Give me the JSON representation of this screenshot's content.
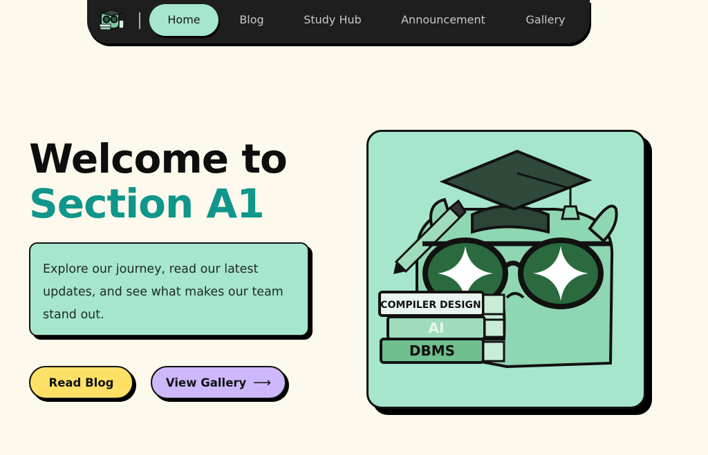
{
  "nav": {
    "items": [
      {
        "label": "Home",
        "active": true
      },
      {
        "label": "Blog",
        "active": false
      },
      {
        "label": "Study Hub",
        "active": false
      },
      {
        "label": "Announcement",
        "active": false
      },
      {
        "label": "Gallery",
        "active": false
      }
    ]
  },
  "hero": {
    "line1": "Welcome to",
    "line2": "Section A1",
    "description": "Explore our journey, read our latest updates, and see what makes our team stand out."
  },
  "buttons": {
    "read_blog": "Read Blog",
    "view_gallery": "View Gallery",
    "view_gallery_arrow": "⟶"
  },
  "mascot": {
    "books": [
      "COMPILER DESIGN",
      "AI",
      "DBMS"
    ]
  },
  "colors": {
    "background": "#fdf9ec",
    "nav": "#1e1e1e",
    "mint": "#a6e6cd",
    "teal_accent": "#10968a",
    "yellow": "#ffe066",
    "lavender": "#cdb8fb"
  },
  "icons": [
    "logo-icon",
    "arrow-right-icon",
    "mascot-illustration"
  ]
}
